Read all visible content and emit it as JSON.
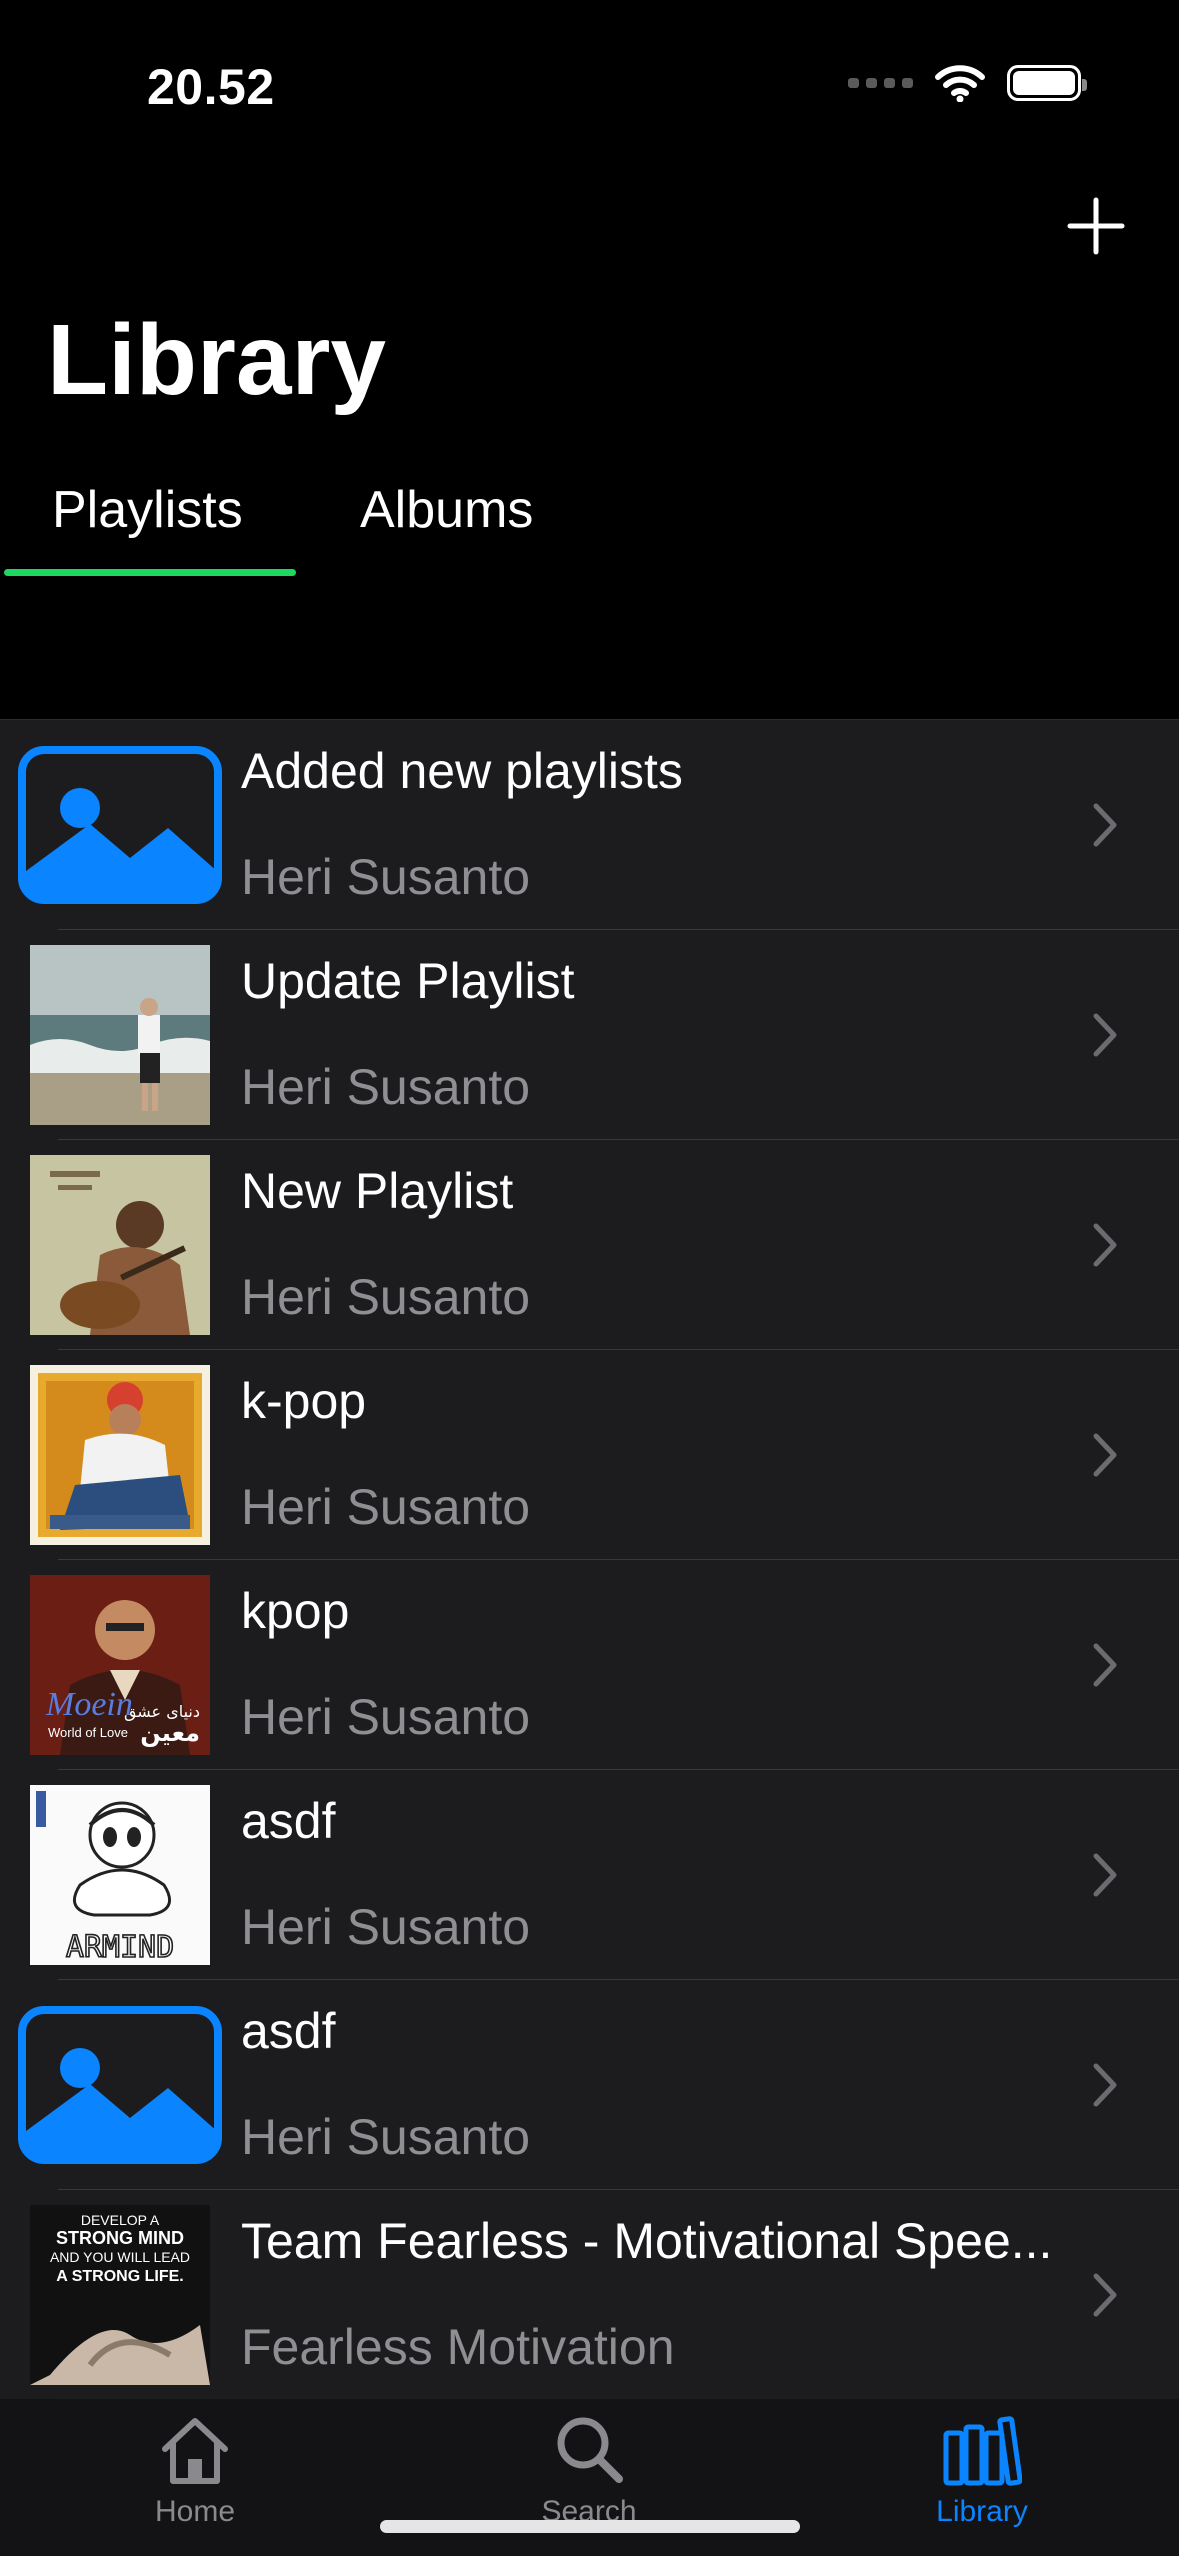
{
  "status_bar": {
    "time": "20.52",
    "signal_icon": "cellular-dots-icon",
    "wifi_icon": "wifi-icon",
    "battery_icon": "battery-icon"
  },
  "header": {
    "title": "Library",
    "add_icon": "plus-icon"
  },
  "tabs": [
    {
      "label": "Playlists",
      "selected": true
    },
    {
      "label": "Albums",
      "selected": false
    }
  ],
  "accent_colors": {
    "tab_indicator": "#1ed760",
    "active_tab_bar": "#0a84ff",
    "placeholder_artwork": "#0a84ff"
  },
  "playlists": [
    {
      "title": "Added new playlists",
      "subtitle": "Heri Susanto",
      "artwork": "placeholder-image-icon"
    },
    {
      "title": "Update Playlist",
      "subtitle": "Heri Susanto",
      "artwork": "beach-album-cover"
    },
    {
      "title": "New Playlist",
      "subtitle": "Heri Susanto",
      "artwork": "guitarist-album-cover"
    },
    {
      "title": "k-pop",
      "subtitle": "Heri Susanto",
      "artwork": "stamp-album-cover"
    },
    {
      "title": "kpop",
      "subtitle": "Heri Susanto",
      "artwork": "portrait-album-cover",
      "artwork_text": {
        "script": "Moein",
        "subtitle": "World of Love",
        "arabic_top": "دنیای عشق",
        "arabic_bottom": "معین"
      }
    },
    {
      "title": "asdf",
      "subtitle": "Heri Susanto",
      "artwork": "armind-album-cover",
      "artwork_text": {
        "logo": "ARMIND"
      }
    },
    {
      "title": "asdf",
      "subtitle": "Heri Susanto",
      "artwork": "placeholder-image-icon"
    },
    {
      "title": "Team Fearless - Motivational Spee...",
      "subtitle": "Fearless Motivation",
      "artwork": "motivation-cover",
      "artwork_text": {
        "line1": "DEVELOP A",
        "line2": "STRONG MIND",
        "line3": "AND YOU WILL LEAD",
        "line4": "A STRONG LIFE."
      }
    }
  ],
  "tab_bar": [
    {
      "label": "Home",
      "icon": "house-icon",
      "selected": false
    },
    {
      "label": "Search",
      "icon": "magnifier-icon",
      "selected": false
    },
    {
      "label": "Library",
      "icon": "books-icon",
      "selected": true
    }
  ]
}
